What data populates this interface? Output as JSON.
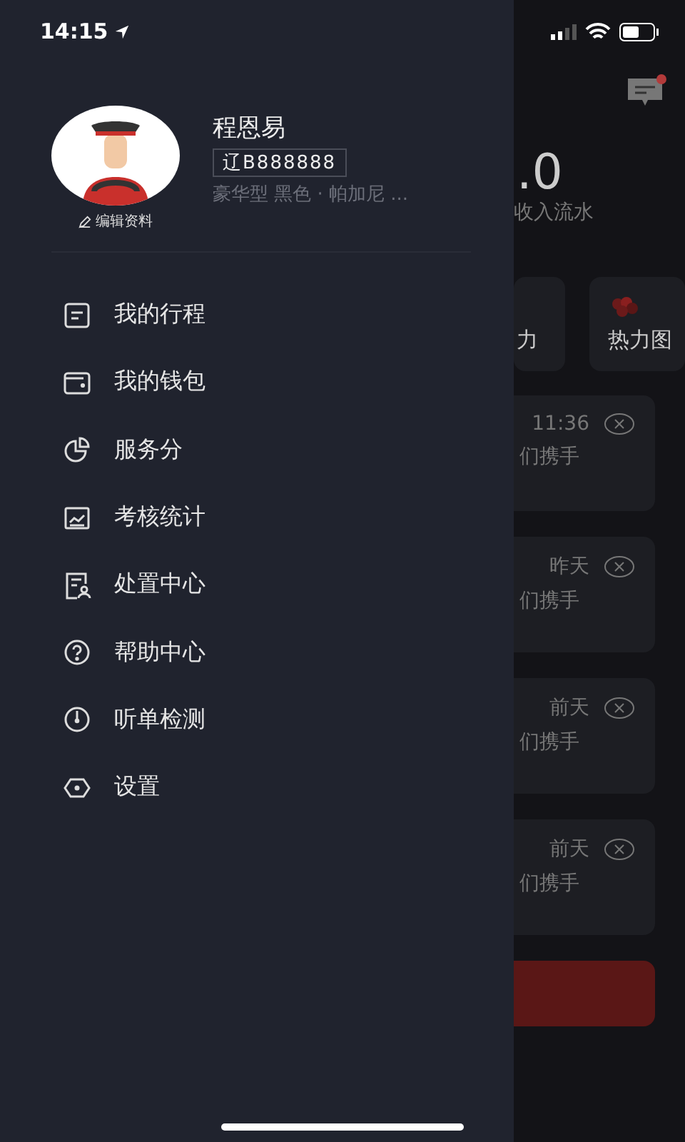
{
  "status_bar": {
    "time": "14:15"
  },
  "profile": {
    "name": "程恩易",
    "plate": "辽B888888",
    "car": "豪华型 黑色 · 帕加尼 ...",
    "edit_label": "编辑资料"
  },
  "menu": [
    {
      "label": "我的行程"
    },
    {
      "label": "我的钱包"
    },
    {
      "label": "服务分"
    },
    {
      "label": "考核统计"
    },
    {
      "label": "处置中心"
    },
    {
      "label": "帮助中心"
    },
    {
      "label": "听单检测"
    },
    {
      "label": "设置"
    }
  ],
  "background": {
    "message_unread": true,
    "income_value": ".0",
    "income_label": "收入流水",
    "shortcuts": [
      {
        "label": "力",
        "kind": "plain"
      },
      {
        "label": "热力图",
        "kind": "heatmap"
      }
    ],
    "notifications": [
      {
        "time": "11:36",
        "text": "们携手"
      },
      {
        "time": "昨天",
        "text": "们携手"
      },
      {
        "time": "前天",
        "text": "们携手"
      },
      {
        "time": "前天",
        "text": "们携手"
      }
    ]
  }
}
